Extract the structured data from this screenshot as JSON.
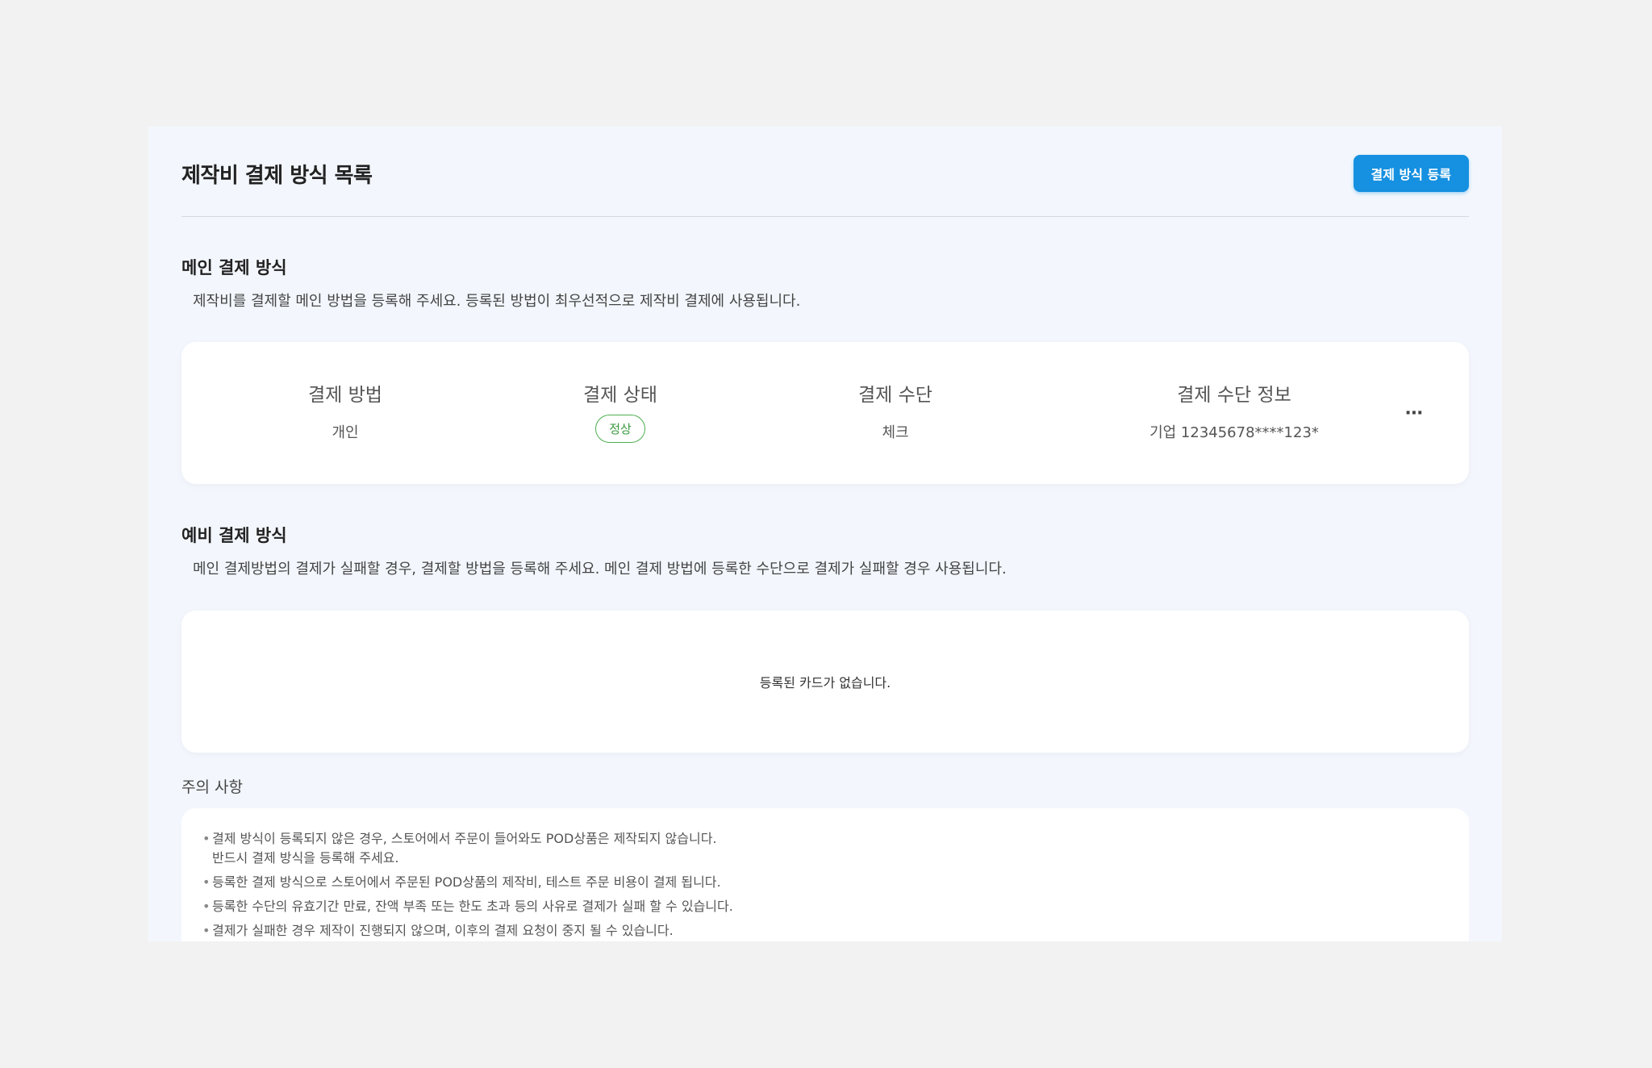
{
  "page": {
    "title": "제작비 결제 방식 목록",
    "register_button": "결제 방식 등록"
  },
  "main_section": {
    "title": "메인 결제 방식",
    "description": "제작비를 결제할 메인 방법을 등록해 주세요. 등록된 방법이 최우선적으로 제작비 결제에 사용됩니다.",
    "columns": {
      "method": "결제 방법",
      "status": "결제 상태",
      "means": "결제 수단",
      "means_info": "결제 수단 정보"
    },
    "row": {
      "method": "개인",
      "status": "정상",
      "means": "체크",
      "means_info": "기업 12345678****123*"
    },
    "more_icon": "more-horizontal-icon",
    "status_color": "#4caf50"
  },
  "backup_section": {
    "title": "예비 결제 방식",
    "description": "메인 결제방법의 결제가 실패할 경우, 결제할 방법을 등록해 주세요. 메인 결제 방법에 등록한 수단으로 결제가 실패할 경우 사용됩니다.",
    "empty_message": "등록된 카드가 없습니다."
  },
  "notice": {
    "title": "주의 사항",
    "items": [
      {
        "line1": "결제 방식이 등록되지 않은 경우, 스토어에서 주문이 들어와도 POD상품은 제작되지 않습니다.",
        "line2": "반드시 결제 방식을 등록해 주세요."
      },
      {
        "line1": "등록한 결제 방식으로 스토어에서 주문된 POD상품의 제작비, 테스트 주문 비용이 결제 됩니다."
      },
      {
        "line1": "등록한 수단의 유효기간 만료, 잔액 부족 또는 한도 초과 등의 사유로 결제가 실패 할 수 있습니다."
      },
      {
        "line1": "결제가 실패한 경우 제작이 진행되지 않으며, 이후의 결제 요청이 중지 될 수 있습니다."
      }
    ]
  },
  "colors": {
    "accent": "#1690e0",
    "panel_bg": "#f3f7fd",
    "page_bg": "#f2f2f2"
  }
}
